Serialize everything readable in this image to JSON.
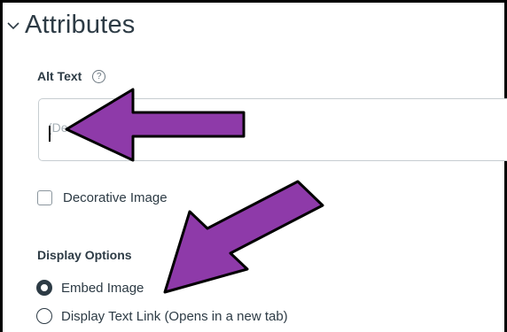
{
  "section": {
    "title": "Attributes",
    "chevron_icon": "chevron-down-icon"
  },
  "alt_text": {
    "label": "Alt Text",
    "help_icon": "question-circle-icon",
    "help_glyph": "?",
    "placeholder": "(De"
  },
  "decorative": {
    "label": "Decorative Image",
    "checked": false
  },
  "display_options": {
    "label": "Display Options",
    "options": [
      {
        "label": "Embed Image",
        "selected": true
      },
      {
        "label": "Display Text Link (Opens in a new tab)",
        "selected": false
      }
    ]
  },
  "annotations": {
    "arrow_color": "#8e3aa9"
  }
}
